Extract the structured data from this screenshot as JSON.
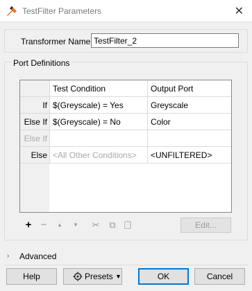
{
  "window": {
    "title": "TestFilter Parameters",
    "close_glyph": "✕"
  },
  "transformer_name": {
    "label": "Transformer Name:",
    "value": "TestFilter_2"
  },
  "port_definitions": {
    "legend": "Port Definitions",
    "columns": [
      "Test Condition",
      "Output Port"
    ],
    "rows": [
      {
        "label": "If",
        "condition": "$(Greyscale) = Yes",
        "port": "Greyscale"
      },
      {
        "label": "Else If",
        "condition": "$(Greyscale) = No",
        "port": "Color"
      },
      {
        "label": "Else If",
        "condition": "",
        "port": ""
      },
      {
        "label": "Else",
        "condition": "<All Other Conditions>",
        "port": "<UNFILTERED>"
      }
    ],
    "toolbar": {
      "add": "+",
      "remove": "−",
      "move_up": "▲",
      "move_down": "▼",
      "cut": "✂",
      "copy": "⧉",
      "paste": "📋",
      "edit_label": "Edit..."
    }
  },
  "advanced": {
    "label": "Advanced",
    "chevron": "›"
  },
  "buttons": {
    "help": "Help",
    "presets": "Presets",
    "presets_caret": "▼",
    "ok": "OK",
    "cancel": "Cancel"
  }
}
